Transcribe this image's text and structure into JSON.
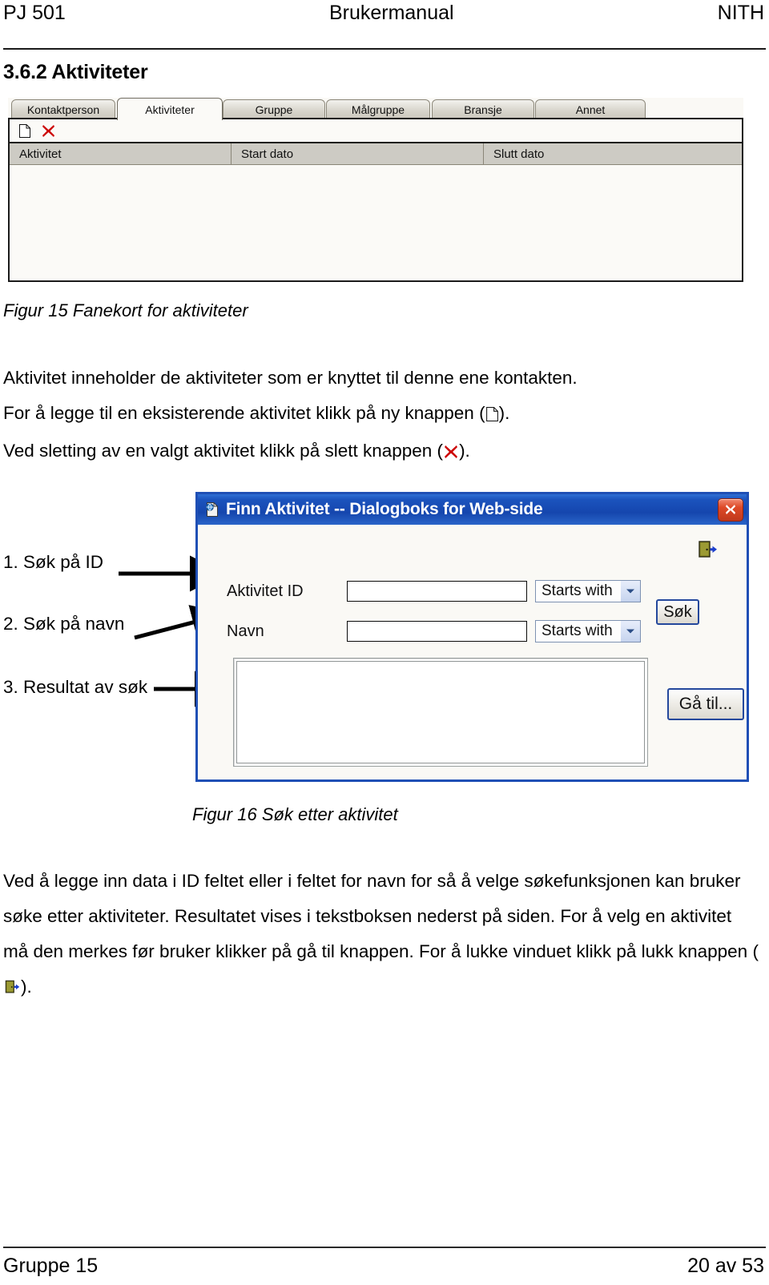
{
  "header": {
    "left": "PJ 501",
    "center": "Brukermanual",
    "right": "NITH"
  },
  "section": {
    "title": "3.6.2 Aktiviteter"
  },
  "tab_screenshot": {
    "tabs": [
      {
        "label": "Kontaktperson",
        "active": false
      },
      {
        "label": "Aktiviteter",
        "active": true
      },
      {
        "label": "Gruppe",
        "active": false
      },
      {
        "label": "Målgruppe",
        "active": false
      },
      {
        "label": "Bransje",
        "active": false
      },
      {
        "label": "Annet",
        "active": false
      }
    ],
    "toolbar": {
      "new_icon": "new-document-icon",
      "delete_icon": "red-x-delete-icon"
    },
    "columns": [
      "Aktivitet",
      "Start dato",
      "Slutt dato"
    ],
    "rows": []
  },
  "captions": {
    "figure_15": "Figur 15 Fanekort for aktiviteter",
    "figure_16": "Figur 16 Søk etter aktivitet"
  },
  "paragraphs": {
    "p1_line1": "Aktivitet inneholder de aktiviteter som er knyttet til denne ene kontakten.",
    "p1_line2_a": "For å legge til en eksisterende aktivitet klikk på ny knappen (",
    "p1_line2_b": ").",
    "p1_line3_a": "Ved sletting av en valgt aktivitet klikk på slett knappen (",
    "p1_line3_b": ").",
    "p2_a": "Ved å legge inn data i ID feltet eller i feltet for navn for så å velge søkefunksjonen kan bruker søke etter aktiviteter. Resultatet vises i tekstboksen nederst på siden. For å velg en aktivitet må den merkes før bruker klikker på gå til knappen. For å lukke vinduet klikk på lukk knappen (",
    "p2_b": ")."
  },
  "annotations": [
    {
      "label": "1. Søk på ID"
    },
    {
      "label": "2. Søk på navn"
    },
    {
      "label": "3. Resultat av søk"
    }
  ],
  "dialog": {
    "title": "Finn Aktivitet -- Dialogboks for Web-side",
    "titlebar_icon": "web-page-icon",
    "close_icon": "close-icon",
    "exit_icon": "exit-door-icon",
    "fields": [
      {
        "label": "Aktivitet ID",
        "value": "",
        "match": "Starts with"
      },
      {
        "label": "Navn",
        "value": "",
        "match": "Starts with"
      }
    ],
    "match_options": [
      "Starts with"
    ],
    "search_button": "Søk",
    "goto_button": "Gå til...",
    "result_box_value": "",
    "colors": {
      "titlebar": "#1546ae",
      "border": "#1f4fb5",
      "close": "#c0381c"
    }
  },
  "footer": {
    "left": "Gruppe 15",
    "right": "20 av 53"
  }
}
